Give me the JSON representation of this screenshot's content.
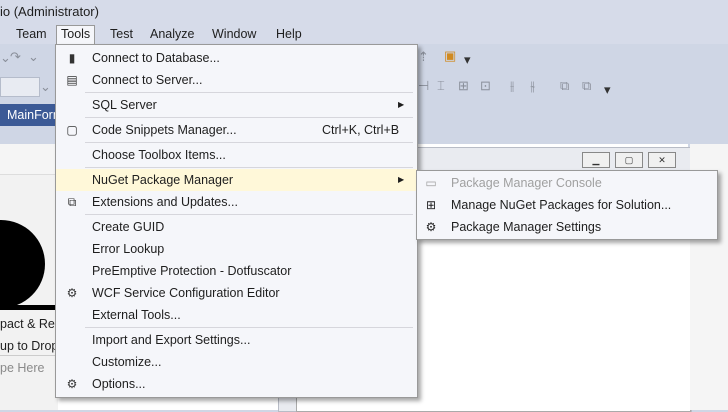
{
  "window": {
    "title": "io (Administrator)"
  },
  "menubar": {
    "items": [
      {
        "label": "Team"
      },
      {
        "label": "Tools"
      },
      {
        "label": "Test"
      },
      {
        "label": "Analyze"
      },
      {
        "label": "Window"
      },
      {
        "label": "Help"
      }
    ]
  },
  "document_tab": {
    "label": "MainForm"
  },
  "left_pane": {
    "line1": "pact & Rep",
    "line2": "up to Drop",
    "placeholder": "pe Here"
  },
  "tools_menu": {
    "items": [
      {
        "label": "Connect to Database...",
        "icon": "database-plus-icon"
      },
      {
        "label": "Connect to Server...",
        "icon": "server-plus-icon"
      },
      {
        "label": "SQL Server",
        "has_submenu": true
      },
      {
        "label": "Code Snippets Manager...",
        "shortcut": "Ctrl+K, Ctrl+B",
        "icon": "snippet-icon"
      },
      {
        "label": "Choose Toolbox Items..."
      },
      {
        "label": "NuGet Package Manager",
        "has_submenu": true,
        "highlighted": true
      },
      {
        "label": "Extensions and Updates...",
        "icon": "extensions-icon"
      },
      {
        "label": "Create GUID"
      },
      {
        "label": "Error Lookup"
      },
      {
        "label": "PreEmptive Protection - Dotfuscator"
      },
      {
        "label": "WCF Service Configuration Editor",
        "icon": "gears-icon"
      },
      {
        "label": "External Tools..."
      },
      {
        "label": "Import and Export Settings..."
      },
      {
        "label": "Customize..."
      },
      {
        "label": "Options...",
        "icon": "gear-icon"
      }
    ]
  },
  "nuget_submenu": {
    "items": [
      {
        "label": "Package Manager Console",
        "disabled": true,
        "icon": "console-icon"
      },
      {
        "label": "Manage NuGet Packages for Solution...",
        "icon": "package-icon"
      },
      {
        "label": "Package Manager Settings",
        "icon": "gear-icon"
      }
    ]
  },
  "colors": {
    "menu_bg": "#f5f6fa",
    "highlight": "#fff8d9",
    "ide_chrome": "#cfd6e5",
    "active_tab": "#3c5a96"
  }
}
